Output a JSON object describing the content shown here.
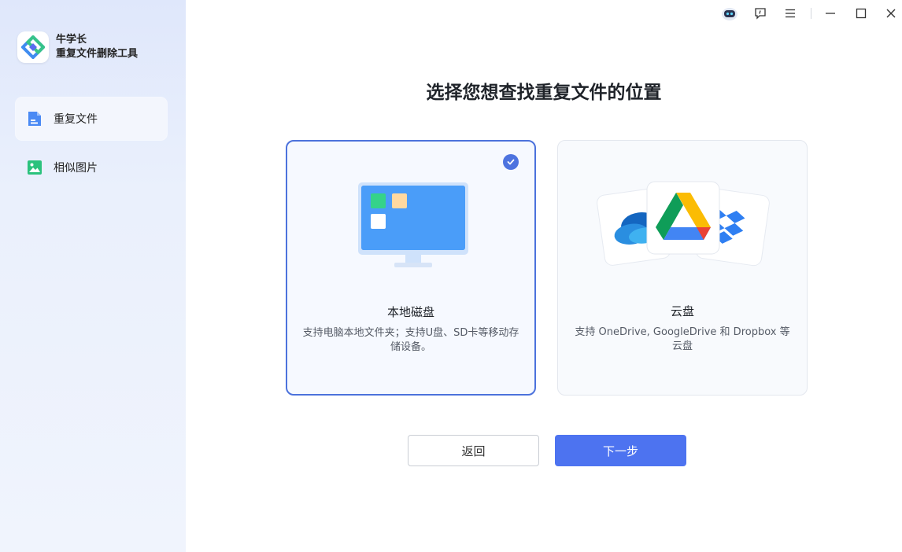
{
  "app": {
    "name": "牛学长",
    "subtitle": "重复文件删除工具"
  },
  "sidebar": {
    "items": [
      {
        "label": "重复文件",
        "icon": "document-icon",
        "active": true,
        "color": "#4a8af4"
      },
      {
        "label": "相似图片",
        "icon": "image-icon",
        "active": false,
        "color": "#2bc27d"
      }
    ]
  },
  "titlebar": {
    "icons": [
      "robot-icon",
      "feedback-icon",
      "menu-icon",
      "minimize-icon",
      "maximize-icon",
      "close-icon"
    ]
  },
  "main": {
    "title": "选择您想查找重复文件的位置",
    "cards": [
      {
        "name": "本地磁盘",
        "desc": "支持电脑本地文件夹；支持U盘、SD卡等移动存储设备。",
        "selected": true
      },
      {
        "name": "云盘",
        "desc": "支持 OneDrive, GoogleDrive 和 Dropbox 等云盘",
        "selected": false
      }
    ],
    "back_label": "返回",
    "next_label": "下一步"
  },
  "colors": {
    "accent": "#4d73f0",
    "selected_border": "#4c72dc"
  }
}
